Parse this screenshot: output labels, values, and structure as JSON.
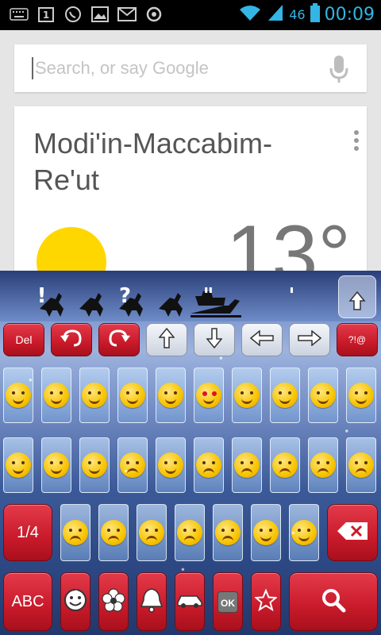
{
  "status_bar": {
    "network": "46",
    "time": "00:09",
    "accent_color": "#33b5e5",
    "left_icons": [
      "keyboard-icon",
      "calendar-icon",
      "whatsapp-icon",
      "gallery-icon",
      "gmail-icon",
      "sync-icon"
    ],
    "calendar_day": "1"
  },
  "search": {
    "placeholder": "Search, or say Google"
  },
  "weather": {
    "location": "Modi'in-Maccabim-Re'ut",
    "temperature": "13°"
  },
  "keyboard": {
    "candidates": [
      "!",
      "?",
      "\"",
      "'"
    ],
    "nav_row": {
      "del": "Del",
      "symbols": "?!@"
    },
    "page": "1/4",
    "abc": "ABC",
    "ok": "OK"
  }
}
